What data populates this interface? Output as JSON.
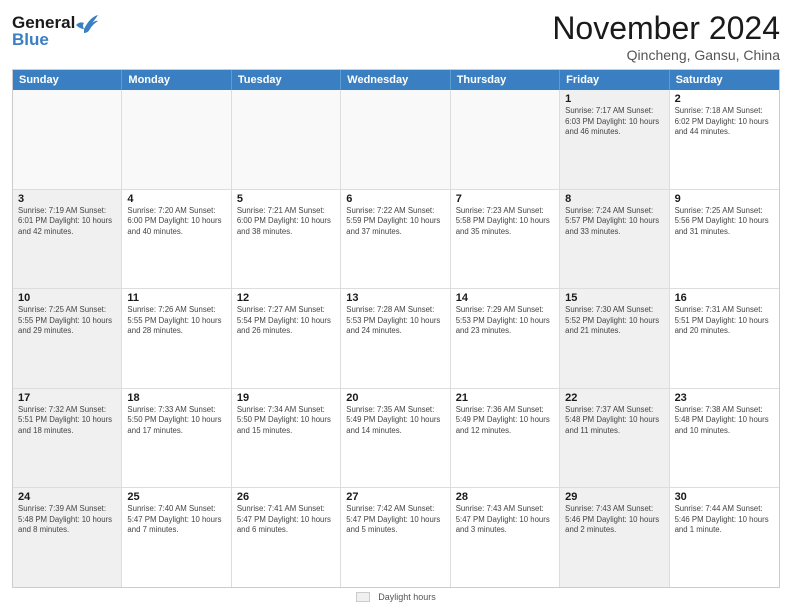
{
  "header": {
    "logo_line1": "General",
    "logo_line2": "Blue",
    "month": "November 2024",
    "location": "Qincheng, Gansu, China"
  },
  "days_of_week": [
    "Sunday",
    "Monday",
    "Tuesday",
    "Wednesday",
    "Thursday",
    "Friday",
    "Saturday"
  ],
  "rows": [
    [
      {
        "day": "",
        "info": "",
        "empty": true
      },
      {
        "day": "",
        "info": "",
        "empty": true
      },
      {
        "day": "",
        "info": "",
        "empty": true
      },
      {
        "day": "",
        "info": "",
        "empty": true
      },
      {
        "day": "",
        "info": "",
        "empty": true
      },
      {
        "day": "1",
        "info": "Sunrise: 7:17 AM\nSunset: 6:03 PM\nDaylight: 10 hours and 46 minutes.",
        "shaded": true
      },
      {
        "day": "2",
        "info": "Sunrise: 7:18 AM\nSunset: 6:02 PM\nDaylight: 10 hours and 44 minutes.",
        "shaded": false
      }
    ],
    [
      {
        "day": "3",
        "info": "Sunrise: 7:19 AM\nSunset: 6:01 PM\nDaylight: 10 hours and 42 minutes.",
        "shaded": true
      },
      {
        "day": "4",
        "info": "Sunrise: 7:20 AM\nSunset: 6:00 PM\nDaylight: 10 hours and 40 minutes."
      },
      {
        "day": "5",
        "info": "Sunrise: 7:21 AM\nSunset: 6:00 PM\nDaylight: 10 hours and 38 minutes."
      },
      {
        "day": "6",
        "info": "Sunrise: 7:22 AM\nSunset: 5:59 PM\nDaylight: 10 hours and 37 minutes."
      },
      {
        "day": "7",
        "info": "Sunrise: 7:23 AM\nSunset: 5:58 PM\nDaylight: 10 hours and 35 minutes."
      },
      {
        "day": "8",
        "info": "Sunrise: 7:24 AM\nSunset: 5:57 PM\nDaylight: 10 hours and 33 minutes.",
        "shaded": true
      },
      {
        "day": "9",
        "info": "Sunrise: 7:25 AM\nSunset: 5:56 PM\nDaylight: 10 hours and 31 minutes."
      }
    ],
    [
      {
        "day": "10",
        "info": "Sunrise: 7:25 AM\nSunset: 5:55 PM\nDaylight: 10 hours and 29 minutes.",
        "shaded": true
      },
      {
        "day": "11",
        "info": "Sunrise: 7:26 AM\nSunset: 5:55 PM\nDaylight: 10 hours and 28 minutes."
      },
      {
        "day": "12",
        "info": "Sunrise: 7:27 AM\nSunset: 5:54 PM\nDaylight: 10 hours and 26 minutes."
      },
      {
        "day": "13",
        "info": "Sunrise: 7:28 AM\nSunset: 5:53 PM\nDaylight: 10 hours and 24 minutes."
      },
      {
        "day": "14",
        "info": "Sunrise: 7:29 AM\nSunset: 5:53 PM\nDaylight: 10 hours and 23 minutes."
      },
      {
        "day": "15",
        "info": "Sunrise: 7:30 AM\nSunset: 5:52 PM\nDaylight: 10 hours and 21 minutes.",
        "shaded": true
      },
      {
        "day": "16",
        "info": "Sunrise: 7:31 AM\nSunset: 5:51 PM\nDaylight: 10 hours and 20 minutes."
      }
    ],
    [
      {
        "day": "17",
        "info": "Sunrise: 7:32 AM\nSunset: 5:51 PM\nDaylight: 10 hours and 18 minutes.",
        "shaded": true
      },
      {
        "day": "18",
        "info": "Sunrise: 7:33 AM\nSunset: 5:50 PM\nDaylight: 10 hours and 17 minutes."
      },
      {
        "day": "19",
        "info": "Sunrise: 7:34 AM\nSunset: 5:50 PM\nDaylight: 10 hours and 15 minutes."
      },
      {
        "day": "20",
        "info": "Sunrise: 7:35 AM\nSunset: 5:49 PM\nDaylight: 10 hours and 14 minutes."
      },
      {
        "day": "21",
        "info": "Sunrise: 7:36 AM\nSunset: 5:49 PM\nDaylight: 10 hours and 12 minutes."
      },
      {
        "day": "22",
        "info": "Sunrise: 7:37 AM\nSunset: 5:48 PM\nDaylight: 10 hours and 11 minutes.",
        "shaded": true
      },
      {
        "day": "23",
        "info": "Sunrise: 7:38 AM\nSunset: 5:48 PM\nDaylight: 10 hours and 10 minutes."
      }
    ],
    [
      {
        "day": "24",
        "info": "Sunrise: 7:39 AM\nSunset: 5:48 PM\nDaylight: 10 hours and 8 minutes.",
        "shaded": true
      },
      {
        "day": "25",
        "info": "Sunrise: 7:40 AM\nSunset: 5:47 PM\nDaylight: 10 hours and 7 minutes."
      },
      {
        "day": "26",
        "info": "Sunrise: 7:41 AM\nSunset: 5:47 PM\nDaylight: 10 hours and 6 minutes."
      },
      {
        "day": "27",
        "info": "Sunrise: 7:42 AM\nSunset: 5:47 PM\nDaylight: 10 hours and 5 minutes."
      },
      {
        "day": "28",
        "info": "Sunrise: 7:43 AM\nSunset: 5:47 PM\nDaylight: 10 hours and 3 minutes."
      },
      {
        "day": "29",
        "info": "Sunrise: 7:43 AM\nSunset: 5:46 PM\nDaylight: 10 hours and 2 minutes.",
        "shaded": true
      },
      {
        "day": "30",
        "info": "Sunrise: 7:44 AM\nSunset: 5:46 PM\nDaylight: 10 hours and 1 minute."
      }
    ]
  ],
  "footer": {
    "legend_label": "Daylight hours"
  }
}
